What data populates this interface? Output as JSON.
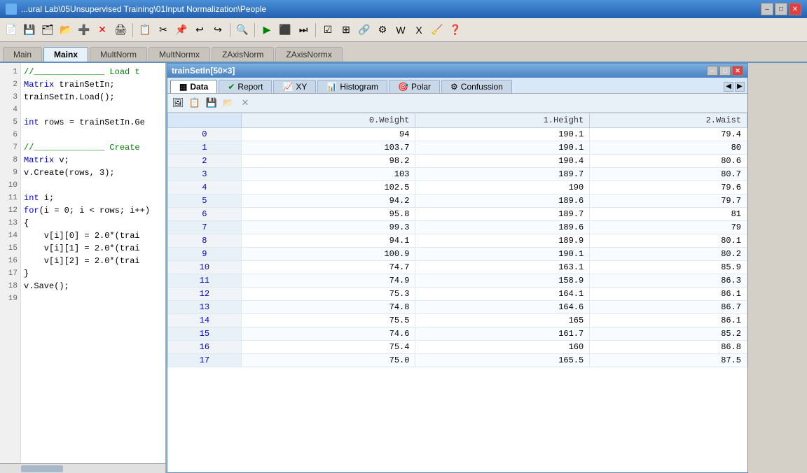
{
  "titlebar": {
    "title": "...ural Lab\\05Unsupervised Training\\01Input Normalization\\People",
    "min_label": "–",
    "max_label": "□",
    "close_label": "✕"
  },
  "tabs": [
    {
      "id": "main",
      "label": "Main",
      "active": false
    },
    {
      "id": "mainx",
      "label": "Mainx",
      "active": true
    },
    {
      "id": "multnorm",
      "label": "MultNorm",
      "active": false
    },
    {
      "id": "multnormx",
      "label": "MultNormx",
      "active": false
    },
    {
      "id": "zaxisnorm",
      "label": "ZAxisNorm",
      "active": false
    },
    {
      "id": "zaxisnormx",
      "label": "ZAxisNormx",
      "active": false
    }
  ],
  "code": {
    "lines": [
      {
        "num": 1,
        "text": "//______________  Load t",
        "tokens": [
          {
            "t": "//______________ Load t",
            "cls": "cm"
          }
        ]
      },
      {
        "num": 2,
        "text": "Matrix trainSetIn;",
        "tokens": [
          {
            "t": "Matrix",
            "cls": "kw"
          },
          {
            "t": " trainSetIn;",
            "cls": "nm"
          }
        ]
      },
      {
        "num": 3,
        "text": "trainSetIn.Load();",
        "tokens": [
          {
            "t": "trainSetIn.Load();",
            "cls": "nm"
          }
        ]
      },
      {
        "num": 4,
        "text": "",
        "tokens": []
      },
      {
        "num": 5,
        "text": "int rows = trainSetIn.Ge",
        "tokens": [
          {
            "t": "int",
            "cls": "kw"
          },
          {
            "t": " rows = trainSetIn.Ge",
            "cls": "nm"
          }
        ]
      },
      {
        "num": 6,
        "text": "",
        "tokens": []
      },
      {
        "num": 7,
        "text": "//______________  Create",
        "tokens": [
          {
            "t": "//______________  Create",
            "cls": "cm"
          }
        ]
      },
      {
        "num": 8,
        "text": "Matrix v;",
        "tokens": [
          {
            "t": "Matrix",
            "cls": "kw"
          },
          {
            "t": " v;",
            "cls": "nm"
          }
        ]
      },
      {
        "num": 9,
        "text": "v.Create(rows, 3);",
        "tokens": [
          {
            "t": "v.Create(rows, 3);",
            "cls": "nm"
          }
        ]
      },
      {
        "num": 10,
        "text": "",
        "tokens": []
      },
      {
        "num": 11,
        "text": "int i;",
        "tokens": [
          {
            "t": "int",
            "cls": "kw"
          },
          {
            "t": " i;",
            "cls": "nm"
          }
        ]
      },
      {
        "num": 12,
        "text": "for(i = 0; i < rows; i++)",
        "tokens": [
          {
            "t": "for",
            "cls": "kw"
          },
          {
            "t": "(i = 0; i < rows; i++)",
            "cls": "nm"
          }
        ]
      },
      {
        "num": 13,
        "text": "{",
        "tokens": [
          {
            "t": "{",
            "cls": "nm"
          }
        ]
      },
      {
        "num": 14,
        "text": "    v[i][0] = 2.0*(trai",
        "tokens": [
          {
            "t": "    v[i][0] = 2.0*(trai",
            "cls": "nm"
          }
        ]
      },
      {
        "num": 15,
        "text": "    v[i][1] = 2.0*(trai",
        "tokens": [
          {
            "t": "    v[i][1] = 2.0*(trai",
            "cls": "nm"
          }
        ]
      },
      {
        "num": 16,
        "text": "    v[i][2] = 2.0*(trai",
        "tokens": [
          {
            "t": "    v[i][2] = 2.0*(trai",
            "cls": "nm"
          }
        ]
      },
      {
        "num": 17,
        "text": "}",
        "tokens": [
          {
            "t": "}",
            "cls": "nm"
          }
        ]
      },
      {
        "num": 18,
        "text": "v.Save();",
        "tokens": [
          {
            "t": "v.Save();",
            "cls": "nm"
          }
        ]
      },
      {
        "num": 19,
        "text": "",
        "tokens": []
      }
    ]
  },
  "datapanel": {
    "title": "trainSetIn[50×3]",
    "tabs": [
      {
        "id": "data",
        "label": "Data",
        "icon": "▦",
        "active": true
      },
      {
        "id": "report",
        "label": "Report",
        "icon": "✔",
        "active": false
      },
      {
        "id": "xy",
        "label": "XY",
        "icon": "📈",
        "active": false
      },
      {
        "id": "histogram",
        "label": "Histogram",
        "icon": "📊",
        "active": false
      },
      {
        "id": "polar",
        "label": "Polar",
        "icon": "🎯",
        "active": false
      },
      {
        "id": "confussion",
        "label": "Confussion",
        "icon": "⚙",
        "active": false
      }
    ],
    "toolbar_buttons": [
      {
        "id": "copy-img",
        "icon": "🖼",
        "label": "copy image"
      },
      {
        "id": "copy",
        "icon": "📋",
        "label": "copy"
      },
      {
        "id": "export",
        "icon": "💾",
        "label": "export"
      },
      {
        "id": "import",
        "icon": "📂",
        "label": "import"
      },
      {
        "id": "delete",
        "icon": "✕",
        "label": "delete"
      }
    ],
    "columns": [
      "",
      "0.Weight",
      "1.Height",
      "2.Waist"
    ],
    "rows": [
      {
        "idx": "0",
        "weight": "94",
        "height": "190.1",
        "waist": "79.4"
      },
      {
        "idx": "1",
        "weight": "103.7",
        "height": "190.1",
        "waist": "80"
      },
      {
        "idx": "2",
        "weight": "98.2",
        "height": "190.4",
        "waist": "80.6"
      },
      {
        "idx": "3",
        "weight": "103",
        "height": "189.7",
        "waist": "80.7"
      },
      {
        "idx": "4",
        "weight": "102.5",
        "height": "190",
        "waist": "79.6"
      },
      {
        "idx": "5",
        "weight": "94.2",
        "height": "189.6",
        "waist": "79.7"
      },
      {
        "idx": "6",
        "weight": "95.8",
        "height": "189.7",
        "waist": "81"
      },
      {
        "idx": "7",
        "weight": "99.3",
        "height": "189.6",
        "waist": "79"
      },
      {
        "idx": "8",
        "weight": "94.1",
        "height": "189.9",
        "waist": "80.1"
      },
      {
        "idx": "9",
        "weight": "100.9",
        "height": "190.1",
        "waist": "80.2"
      },
      {
        "idx": "10",
        "weight": "74.7",
        "height": "163.1",
        "waist": "85.9"
      },
      {
        "idx": "11",
        "weight": "74.9",
        "height": "158.9",
        "waist": "86.3"
      },
      {
        "idx": "12",
        "weight": "75.3",
        "height": "164.1",
        "waist": "86.1"
      },
      {
        "idx": "13",
        "weight": "74.8",
        "height": "164.6",
        "waist": "86.7"
      },
      {
        "idx": "14",
        "weight": "75.5",
        "height": "165",
        "waist": "86.1"
      },
      {
        "idx": "15",
        "weight": "74.6",
        "height": "161.7",
        "waist": "85.2"
      },
      {
        "idx": "16",
        "weight": "75.4",
        "height": "160",
        "waist": "86.8"
      },
      {
        "idx": "17",
        "weight": "75.0",
        "height": "165.5",
        "waist": "87.5"
      }
    ]
  }
}
